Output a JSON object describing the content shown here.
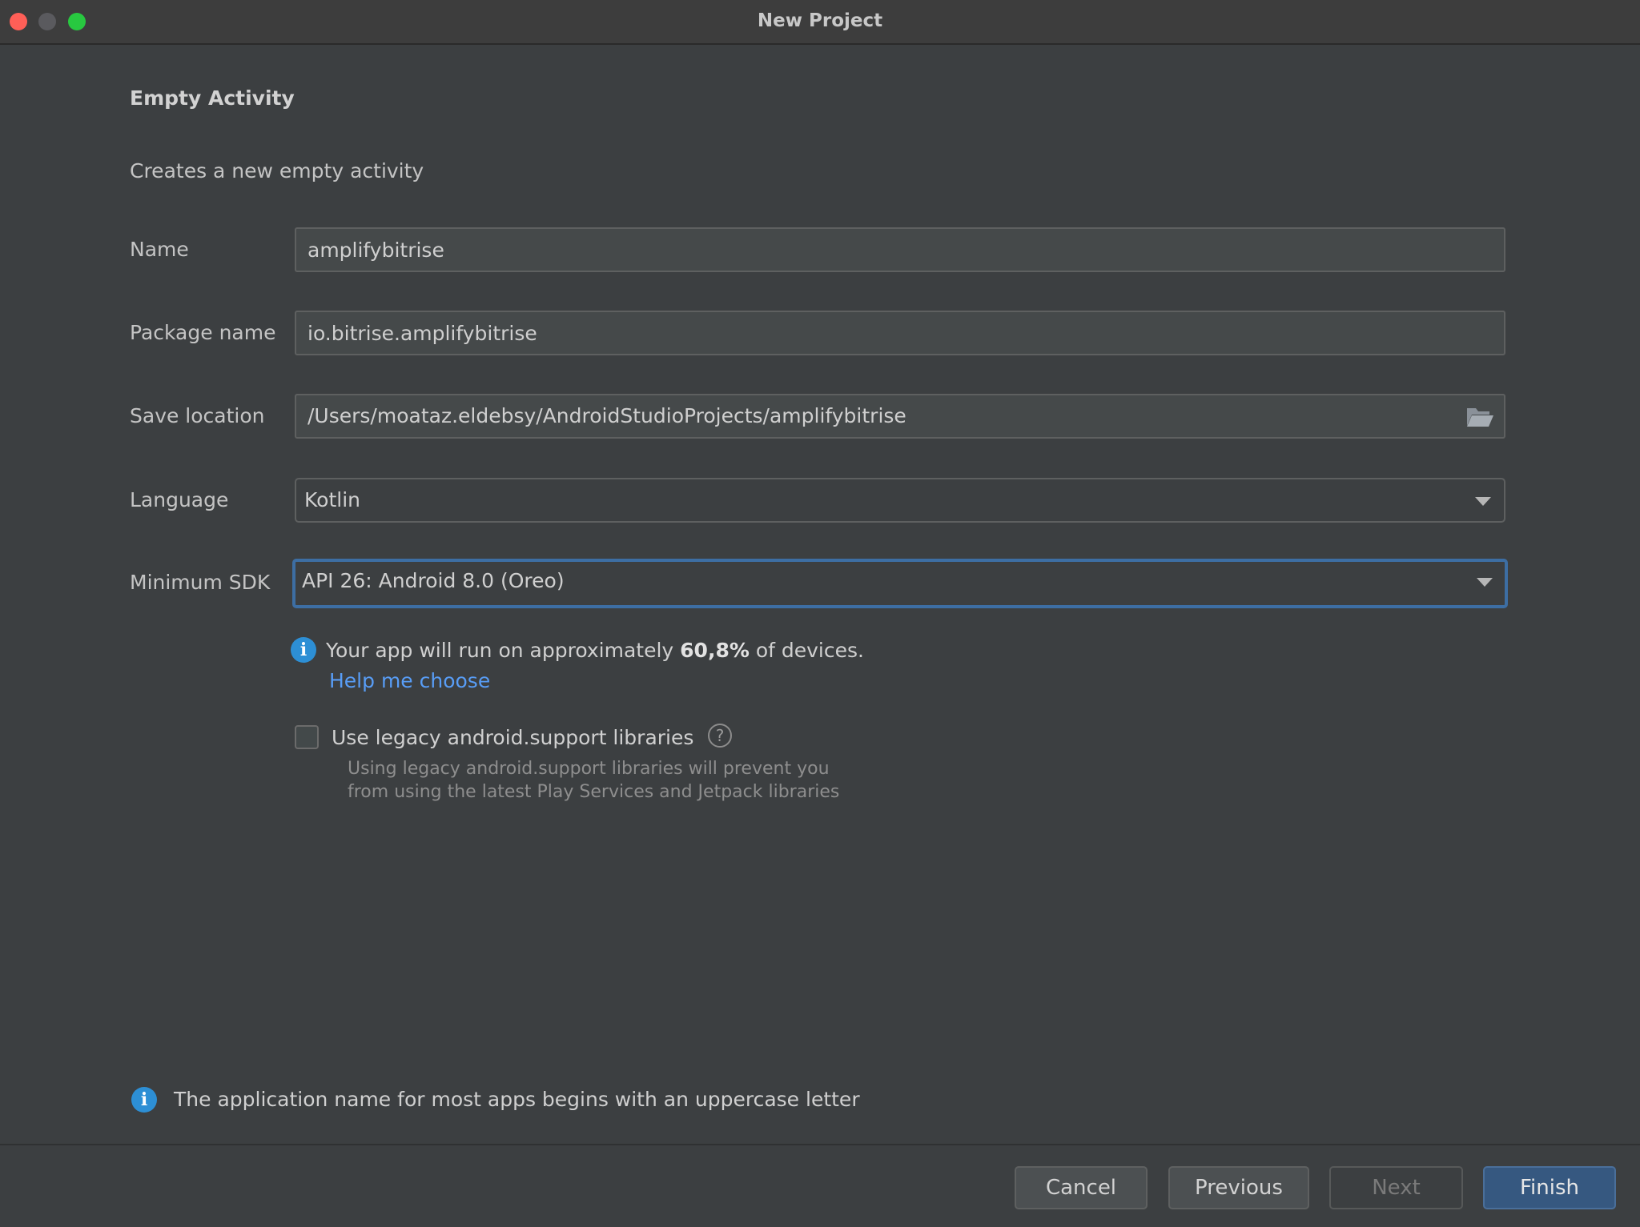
{
  "window": {
    "title": "New Project"
  },
  "page": {
    "heading": "Empty Activity",
    "subheading": "Creates a new empty activity"
  },
  "form": {
    "name": {
      "label": "Name",
      "value": "amplifybitrise"
    },
    "package_name": {
      "label": "Package name",
      "value": "io.bitrise.amplifybitrise"
    },
    "save_location": {
      "label": "Save location",
      "value": "/Users/moataz.eldebsy/AndroidStudioProjects/amplifybitrise"
    },
    "language": {
      "label": "Language",
      "value": "Kotlin"
    },
    "minimum_sdk": {
      "label": "Minimum SDK",
      "value": "API 26: Android 8.0 (Oreo)"
    }
  },
  "sdk_info": {
    "prefix": "Your app will run on approximately ",
    "percentage": "60,8%",
    "suffix": " of devices.",
    "help_link": "Help me choose"
  },
  "legacy": {
    "checkbox_label": "Use legacy android.support libraries",
    "checked": false,
    "hint_line1": "Using legacy android.support libraries will prevent you",
    "hint_line2": "from using the latest Play Services and Jetpack libraries"
  },
  "validation": {
    "message": "The application name for most apps begins with an uppercase letter"
  },
  "buttons": {
    "cancel": "Cancel",
    "previous": "Previous",
    "next": "Next",
    "finish": "Finish"
  },
  "icons": {
    "info": "info-icon",
    "help": "question-mark-icon",
    "folder": "folder-open-icon",
    "dropdown": "chevron-down-icon"
  },
  "colors": {
    "accent": "#3d6ea3",
    "link": "#589df6",
    "info": "#2d8fd5",
    "primary_button": "#365880"
  }
}
